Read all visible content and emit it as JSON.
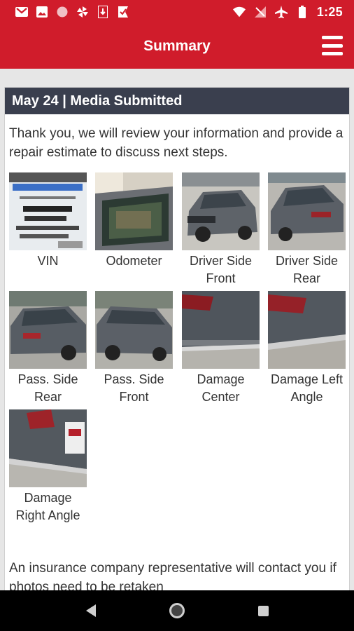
{
  "status_bar": {
    "time": "1:25",
    "left_icons": [
      "gmail-icon",
      "image-icon",
      "circle-icon",
      "pinwheel-icon",
      "download-icon",
      "check-flag-icon"
    ],
    "right_icons": [
      "wifi-icon",
      "no-signal-icon",
      "airplane-icon",
      "battery-icon"
    ]
  },
  "app_bar": {
    "title": "Summary",
    "menu_icon": "hamburger-menu-icon",
    "color": "#d01c2b"
  },
  "card": {
    "header": "May 24 | Media Submitted",
    "header_color": "#3a3f4e",
    "intro": "Thank you, we will review your information and provide a repair estimate to discuss next steps.",
    "photos": [
      {
        "label": "VIN"
      },
      {
        "label": "Odometer"
      },
      {
        "label": "Driver Side Front"
      },
      {
        "label": "Driver Side Rear"
      },
      {
        "label": "Pass. Side Rear"
      },
      {
        "label": "Pass. Side Front"
      },
      {
        "label": "Damage Center"
      },
      {
        "label": "Damage Left Angle"
      },
      {
        "label": "Damage Right Angle"
      }
    ],
    "outro": "An insurance company representative will contact you if photos need to be retaken"
  },
  "nav_bar": {
    "icons": [
      "back-icon",
      "home-icon",
      "recents-icon"
    ]
  }
}
